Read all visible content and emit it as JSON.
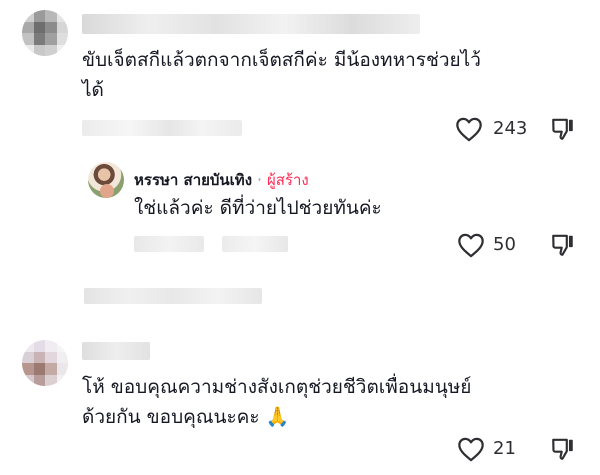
{
  "comments": [
    {
      "text_line1": "ขับเจ็ตสกีแล้วตกจากเจ็ตสกีค่ะ มีน้องทหารช่วยไว้",
      "text_line2": "ได้",
      "likes": "243"
    },
    {
      "text_line1": "โห้ ขอบคุณความช่างสังเกตุช่วยชีวิตเพื่อนมนุษย์",
      "text_line2": "ด้วยกัน ขอบคุณนะคะ",
      "emoji": "🙏",
      "likes": "21"
    }
  ],
  "reply": {
    "author": "หรรษา สายบันเทิง",
    "separator": "·",
    "creator_label": "ผู้สร้าง",
    "text": "ใช่แล้วค่ะ ดีที่ว่ายไปช่วยทันค่ะ",
    "likes": "50"
  },
  "icons": {
    "like": "heart-outline-icon",
    "dislike": "thumbs-down-icon"
  },
  "colors": {
    "creator_accent": "#fe2c55",
    "text": "#161823",
    "blur_bar": "#eeeeee"
  }
}
